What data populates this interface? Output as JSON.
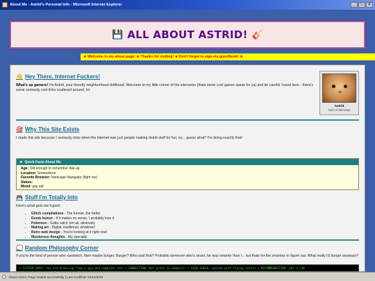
{
  "window": {
    "title": "About Me - Astrid's Personal Info - Microsoft Internet Explorer",
    "buttons": [
      "_",
      "□",
      "×"
    ]
  },
  "banner": {
    "title": "ALL ABOUT ASTRID!",
    "left_emoji": "💾",
    "right_emoji": "🎸"
  },
  "marquee": "★ Welcome to my about page! ★ Thanks for visiting! ★ Don't forget to sign my guestbook! ★",
  "intro": {
    "heading_emoji": "👋",
    "heading": "Hey There, Internet Fuckers!",
    "lead": "What's up gamers!",
    "text": " I'm Astrid, your friendly neighborhood shitfhead. Welcome to my little corner of the interwebs (thats some cool gamer speak for ya) and be careful 'round here - there's some seriously cool links scattered around, lol."
  },
  "avatar": {
    "name": "Astrid",
    "caption": "CEO of Memings"
  },
  "why": {
    "heading_emoji": "🎯",
    "heading": "Why This Site Exists",
    "text": "I made this site because I seriously miss when the internet was just people making dumb stuff for fun, so... guess what? I'm doing exactly that!"
  },
  "facts": {
    "header_icon": "★",
    "header": "Quick Facts About Me",
    "rows": [
      {
        "label": "Age:",
        "value": " Old enough to remember dial-up"
      },
      {
        "label": "Location:",
        "value": " Somewhere"
      },
      {
        "label": "Favorite Browser:",
        "value": " Netscape Navigator (fight me)"
      },
      {
        "label": "Status:",
        "value": ""
      },
      {
        "label": "Mood:",
        "value": " gay asf"
      }
    ]
  },
  "stuff": {
    "heading_emoji": "🎮",
    "heading": "Stuff I'm Totally Into",
    "intro": "Here's what gets me hyped:",
    "items": [
      {
        "name": "Glitch compilations",
        "desc": " - The funnier, the better"
      },
      {
        "name": "Dumb humor",
        "desc": " - If it makes no sense, I probably love it"
      },
      {
        "name": "Pokémon",
        "desc": " - Gotta catch 'em all, obviously"
      },
      {
        "name": "Making art",
        "desc": " - Digital, traditional, whatever!"
      },
      {
        "name": "Retro web design",
        "desc": " - You're looking at it right now!"
      },
      {
        "name": "Murderous thoughts",
        "desc": " - My specialty"
      }
    ]
  },
  "philosophy": {
    "heading_emoji": "💭",
    "heading": "Random Philosophy Corner",
    "text": "If you're the kind of person who sandwich, then maybe burger. Burger? Who said that? Probably someone who's smart, far way smarter than I... but thats for the smarties to figure out. What really IS burger anyways?"
  },
  "terminal": "> SYSTEM INFO: You are browsing from a guy and computer but > CONNECTION: Not great IS dumbest! > VIBE CHECK: passed with flying colors > RECOMMENDATION: get a job",
  "status": "About Astrid | Page loaded successfully | Last modified: 03/15/2001"
}
